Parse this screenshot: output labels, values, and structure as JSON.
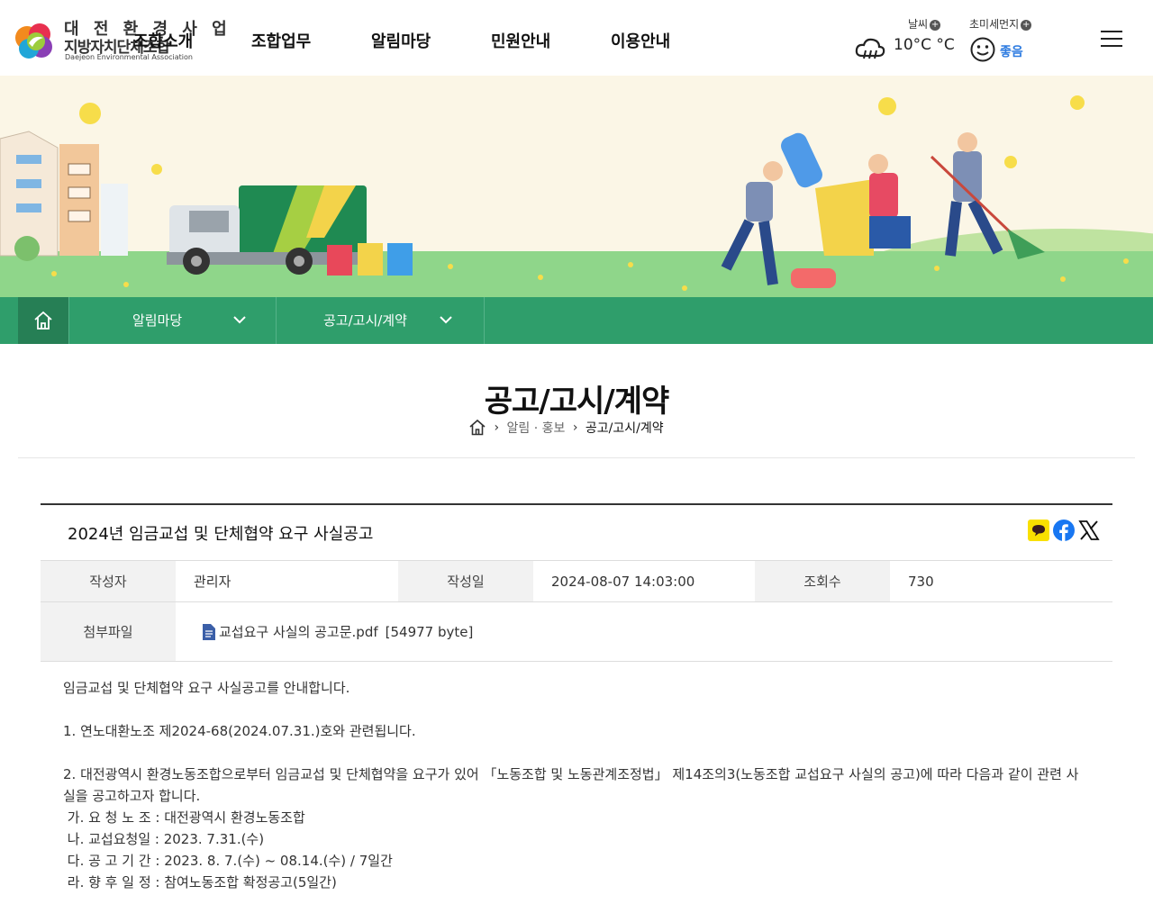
{
  "header": {
    "logo": {
      "name_line1": "대 전 환 경 사 업",
      "name_line2": "지방자치단체조합",
      "name_en": "Daejeon Environmental Association",
      "overlap_menu": "조합소개"
    },
    "gnb": [
      "조합업무",
      "알림마당",
      "민원안내",
      "이용안내"
    ],
    "weather": {
      "label": "날씨",
      "temp": "10°C °C",
      "icon": "cloud-rain-icon"
    },
    "fine_dust": {
      "label": "초미세먼지",
      "value": "좋음",
      "value_color": "#2d7be0",
      "icon": "smile-face-icon"
    },
    "menu_icon": "hamburger-menu-icon"
  },
  "subnav": {
    "bg_color": "#2f9e6b",
    "home_icon": "home-icon",
    "dropdowns": [
      "알림마당",
      "공고/고시/계약"
    ]
  },
  "page": {
    "title": "공고/고시/계약",
    "breadcrumb": [
      "알림 · 홍보",
      "공고/고시/계약"
    ]
  },
  "board": {
    "title": "2024년 임금교섭 및 단체협약 요구 사실공고",
    "share": [
      "kakaotalk-icon",
      "facebook-icon",
      "x-twitter-icon"
    ],
    "meta": {
      "author_label": "작성자",
      "author": "관리자",
      "date_label": "작성일",
      "date": "2024-08-07 14:03:00",
      "views_label": "조회수",
      "views": "730",
      "file_label": "첨부파일",
      "file_name": "교섭요구 사실의 공고문.pdf",
      "file_size": "[54977 byte]"
    },
    "content": [
      "임금교섭 및 단체협약 요구 사실공고를 안내합니다.",
      "",
      "1. 연노대환노조 제2024-68(2024.07.31.)호와 관련됩니다.",
      "",
      "2. 대전광역시 환경노동조합으로부터 임금교섭 및 단체협약을 요구가 있어 「노동조합 및 노동관계조정법」 제14조의3(노동조합 교섭요구 사실의 공고)에 따라 다음과 같이 관련 사실을 공고하고자 합니다.",
      " 가. 요 청 노 조 : 대전광역시 환경노동조합",
      " 나. 교섭요청일 : 2023. 7.31.(수)",
      " 다. 공 고 기 간 : 2023. 8. 7.(수) ~ 08.14.(수) / 7일간",
      " 라. 향 후 일 정 : 참여노동조합 확정공고(5일간)"
    ]
  }
}
